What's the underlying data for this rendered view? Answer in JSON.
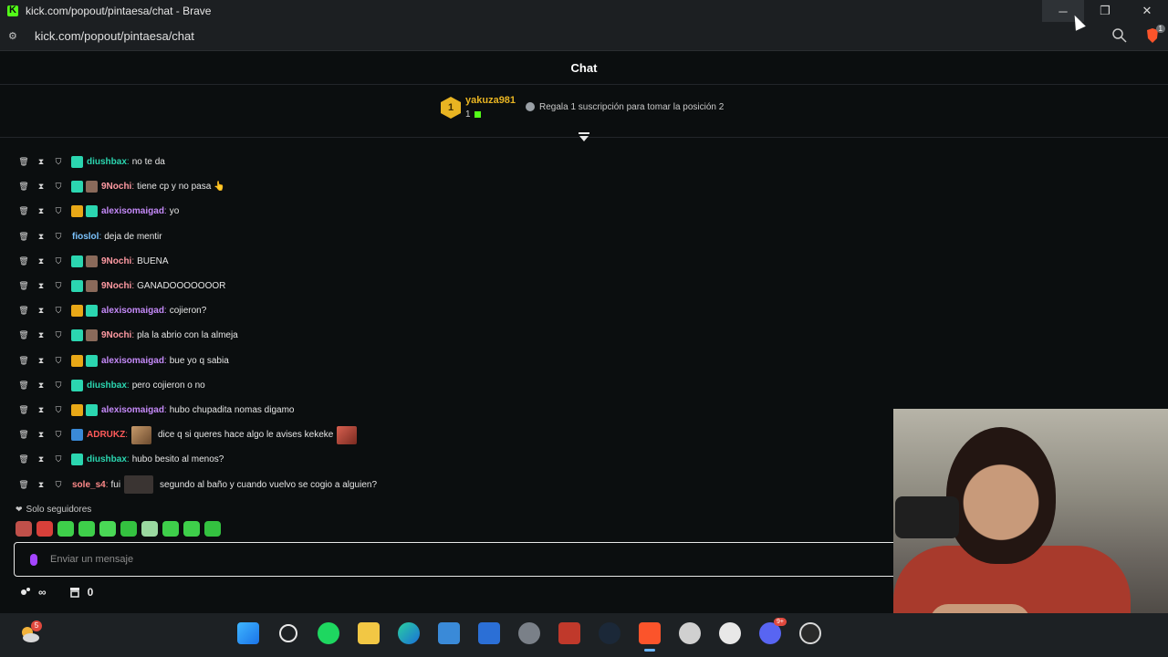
{
  "browser": {
    "window_title": "kick.com/popout/pintaesa/chat - Brave",
    "url": "kick.com/popout/pintaesa/chat",
    "brave_badge": "1",
    "controls": {
      "minimize": "─",
      "restore": "❐",
      "close": "✕"
    }
  },
  "chat": {
    "title": "Chat",
    "leaderboard": {
      "rank": "1",
      "username": "yakuza981",
      "count": "1",
      "promo": "Regala 1 suscripción para tomar la posición 2"
    },
    "messages": [
      {
        "badges": [
          "sub"
        ],
        "username": "diushbax",
        "color": "teal",
        "text": "no te da"
      },
      {
        "badges": [
          "sub",
          "avatar"
        ],
        "username": "9Nochi",
        "color": "pink",
        "text": "tiene cp y no pasa",
        "emoji": "👆"
      },
      {
        "badges": [
          "crown",
          "sub"
        ],
        "username": "alexisomaigad",
        "color": "purple",
        "text": "yo"
      },
      {
        "badges": [],
        "username": "fioslol",
        "color": "blue",
        "text": "deja de mentir"
      },
      {
        "badges": [
          "sub",
          "avatar"
        ],
        "username": "9Nochi",
        "color": "pink",
        "text": "BUENA"
      },
      {
        "badges": [
          "sub",
          "avatar"
        ],
        "username": "9Nochi",
        "color": "pink",
        "text": "GANADOOOOOOOR"
      },
      {
        "badges": [
          "crown",
          "sub"
        ],
        "username": "alexisomaigad",
        "color": "purple",
        "text": "cojieron?"
      },
      {
        "badges": [
          "sub",
          "avatar"
        ],
        "username": "9Nochi",
        "color": "pink",
        "text": "pla la abrio con la almeja"
      },
      {
        "badges": [
          "crown",
          "sub"
        ],
        "username": "alexisomaigad",
        "color": "purple",
        "text": "bue yo q sabia"
      },
      {
        "badges": [
          "sub"
        ],
        "username": "diushbax",
        "color": "teal",
        "text": "pero cojieron o no"
      },
      {
        "badges": [
          "crown",
          "sub"
        ],
        "username": "alexisomaigad",
        "color": "purple",
        "text": "hubo chupadita nomas digamo"
      },
      {
        "badges": [
          "verified"
        ],
        "username": "ADRUKZ",
        "color": "red",
        "text": "dice q si queres hace algo le avises kekeke",
        "emote_before": true,
        "emote_after": true
      },
      {
        "badges": [
          "sub"
        ],
        "username": "diushbax",
        "color": "teal",
        "text": "hubo besito al menos?"
      },
      {
        "badges": [],
        "username": "sole_s4",
        "color": "peach",
        "text": "fui",
        "text2": "segundo al baño y cuando vuelvo se cogio a alguien?"
      }
    ],
    "followers_only": "Solo seguidores",
    "input_placeholder": "Enviar un mensaje",
    "footer": {
      "infinity": "∞",
      "count": "0"
    }
  },
  "taskbar": {
    "weather_badge": "5",
    "discord_badge": "9+"
  }
}
